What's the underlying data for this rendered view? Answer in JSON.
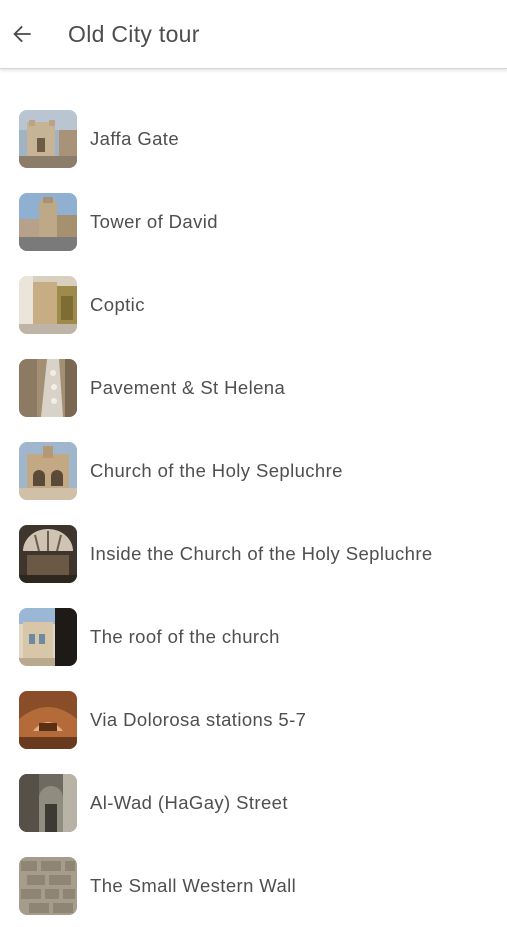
{
  "header": {
    "title": "Old City tour",
    "back_icon": "arrow-left-icon"
  },
  "stops": [
    {
      "label": "Jaffa Gate",
      "thumb": "jaffa-gate-photo"
    },
    {
      "label": "Tower of David",
      "thumb": "tower-of-david-photo"
    },
    {
      "label": "Coptic",
      "thumb": "coptic-photo"
    },
    {
      "label": "Pavement & St Helena",
      "thumb": "pavement-st-helena-photo"
    },
    {
      "label": "Church of the Holy Sepluchre",
      "thumb": "holy-sepluchre-photo"
    },
    {
      "label": "Inside the Church of the Holy Sepluchre",
      "thumb": "inside-church-photo"
    },
    {
      "label": "The roof of the church",
      "thumb": "church-roof-photo"
    },
    {
      "label": "Via Dolorosa stations 5-7",
      "thumb": "via-dolorosa-photo"
    },
    {
      "label": "Al-Wad (HaGay) Street",
      "thumb": "al-wad-street-photo"
    },
    {
      "label": "The Small Western Wall",
      "thumb": "small-western-wall-photo"
    }
  ]
}
